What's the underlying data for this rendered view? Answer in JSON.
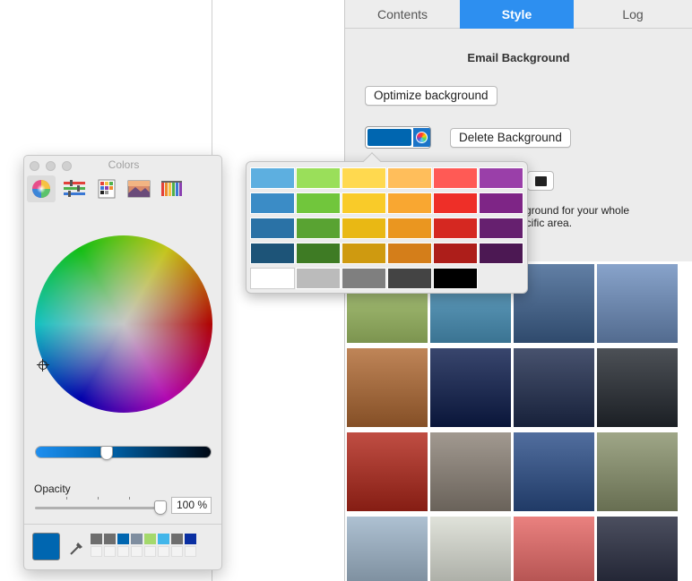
{
  "tabs": [
    "Contents",
    "Style",
    "Log"
  ],
  "section_title": "Email Background",
  "buttons": {
    "optimize": "Optimize background",
    "delete": "Delete Background"
  },
  "description_lines": [
    "kground for your whole",
    "ecific area."
  ],
  "current_color": "#0066b0",
  "popover_colors": [
    [
      "#5dafe0",
      "#9adf5a",
      "#ffd94f",
      "#ffbe5b",
      "#ff5a55",
      "#9a3fa9"
    ],
    [
      "#3b8cc6",
      "#71c63c",
      "#f9cb29",
      "#f9a731",
      "#ee2f28",
      "#7e2586"
    ],
    [
      "#2a72a6",
      "#59a332",
      "#e9b814",
      "#ea9620",
      "#d52821",
      "#66206f"
    ],
    [
      "#1d5478",
      "#3e7b24",
      "#cf9a10",
      "#d47e1a",
      "#ad1e1a",
      "#4c1853"
    ],
    [
      "#ffffff",
      "#bbbbbb",
      "#7f7f7f",
      "#444444",
      "#000000"
    ]
  ],
  "colors_window": {
    "title": "Colors",
    "tool_icons": [
      "color-wheel-icon",
      "color-sliders-icon",
      "color-palettes-icon",
      "image-palettes-icon",
      "pencils-icon"
    ],
    "opacity_label": "Opacity",
    "opacity_value": "100 %",
    "opacity_level": 1.0,
    "brightness_level": 0.4,
    "swatches": [
      "#6e6e6e",
      "#6e6e6e",
      "#0066b0",
      "#7f8ea0",
      "#a4d96c",
      "#42b6ea",
      "#6e6e6e",
      "#0a2fa2"
    ]
  },
  "thumbnails": [
    [
      "#a6c66a",
      "#4e9ac3",
      "#3f6391",
      "#6e8fbf"
    ],
    [
      "#b16a33",
      "#0d1d4d",
      "#1f2c4e",
      "#252a31"
    ],
    [
      "#b2271a",
      "#8d8378",
      "#2b4e89",
      "#8a936d"
    ],
    [
      "#9cb3c8",
      "#d9dcd2",
      "#e56563",
      "#24283c"
    ]
  ]
}
